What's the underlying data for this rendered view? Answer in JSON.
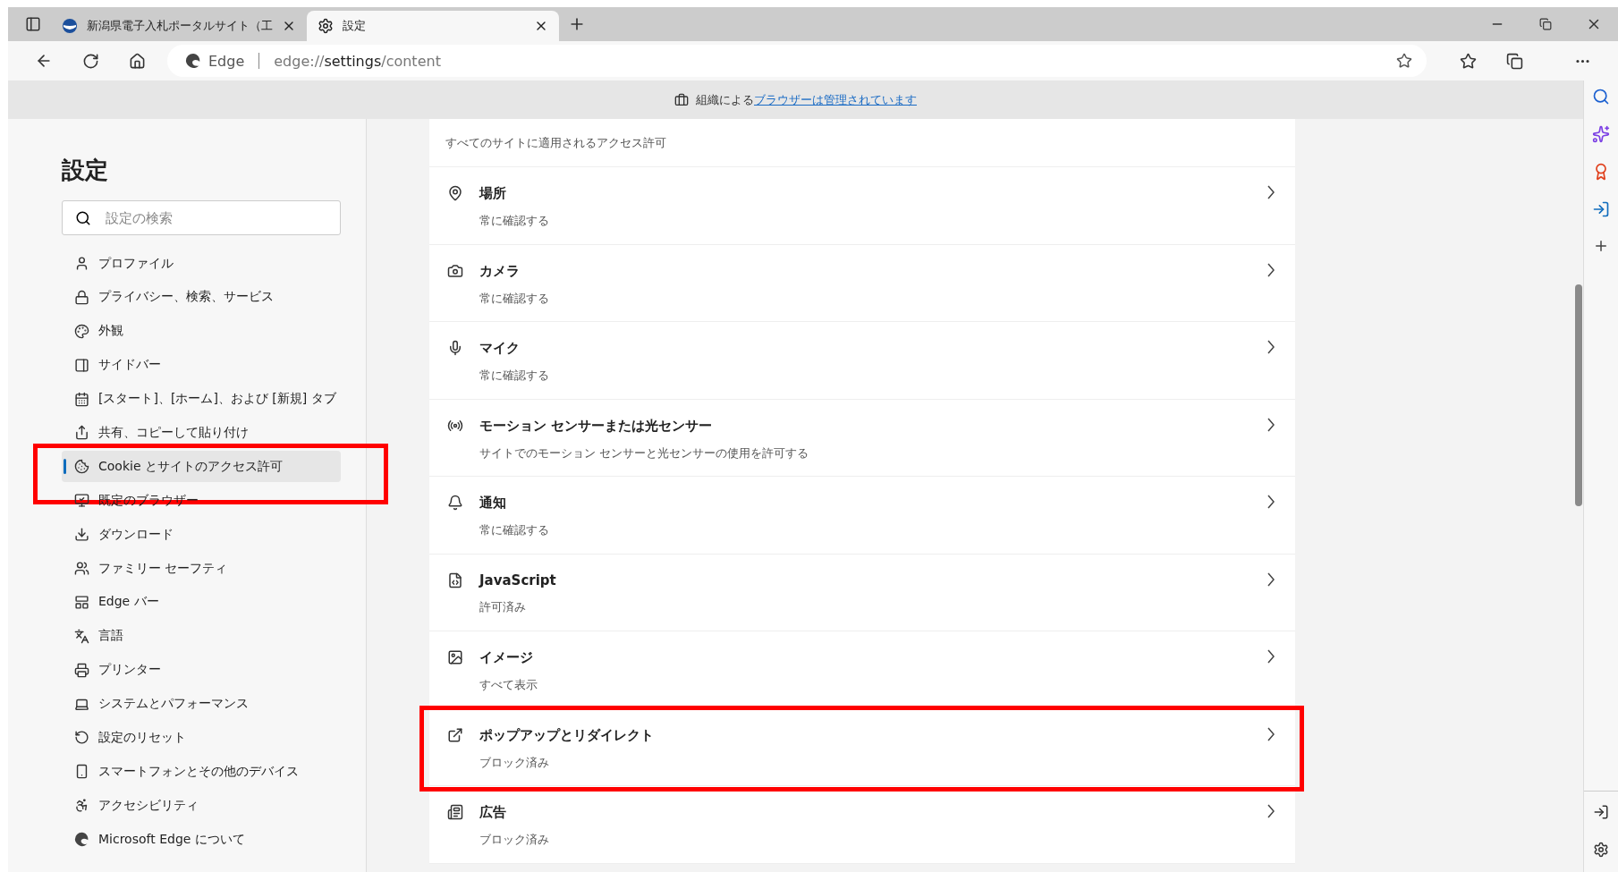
{
  "tabs": [
    {
      "title": "新潟県電子入札ポータルサイト（工",
      "selected": false,
      "kind": "site"
    },
    {
      "title": "設定",
      "selected": true,
      "kind": "settings"
    }
  ],
  "address": {
    "brand": "Edge",
    "url_scheme": "edge://",
    "url_host": "settings",
    "url_path": "/content"
  },
  "info_bar": {
    "text": "組織による",
    "link": "ブラウザーは管理されています"
  },
  "sidebar": {
    "title": "設定",
    "search": {
      "placeholder": "設定の検索"
    },
    "items": [
      {
        "label": "プロファイル",
        "selected": false,
        "highlighted": false
      },
      {
        "label": "プライバシー、検索、サービス",
        "selected": false,
        "highlighted": false
      },
      {
        "label": "外観",
        "selected": false,
        "highlighted": false
      },
      {
        "label": "サイドバー",
        "selected": false,
        "highlighted": false
      },
      {
        "label": "[スタート]、[ホーム]、および [新規] タブ",
        "selected": false,
        "highlighted": false
      },
      {
        "label": "共有、コピーして貼り付け",
        "selected": false,
        "highlighted": false
      },
      {
        "label": "Cookie とサイトのアクセス許可",
        "selected": true,
        "highlighted": true
      },
      {
        "label": "既定のブラウザー",
        "selected": false,
        "highlighted": false
      },
      {
        "label": "ダウンロード",
        "selected": false,
        "highlighted": false
      },
      {
        "label": "ファミリー セーフティ",
        "selected": false,
        "highlighted": false
      },
      {
        "label": "Edge バー",
        "selected": false,
        "highlighted": false
      },
      {
        "label": "言語",
        "selected": false,
        "highlighted": false
      },
      {
        "label": "プリンター",
        "selected": false,
        "highlighted": false
      },
      {
        "label": "システムとパフォーマンス",
        "selected": false,
        "highlighted": false
      },
      {
        "label": "設定のリセット",
        "selected": false,
        "highlighted": false
      },
      {
        "label": "スマートフォンとその他のデバイス",
        "selected": false,
        "highlighted": false
      },
      {
        "label": "アクセシビリティ",
        "selected": false,
        "highlighted": false
      },
      {
        "label": "Microsoft Edge について",
        "selected": false,
        "highlighted": false
      }
    ]
  },
  "content": {
    "section_description": "すべてのサイトに適用されるアクセス許可",
    "rows": [
      {
        "title": "場所",
        "subtitle": "常に確認する",
        "highlighted": false
      },
      {
        "title": "カメラ",
        "subtitle": "常に確認する",
        "highlighted": false
      },
      {
        "title": "マイク",
        "subtitle": "常に確認する",
        "highlighted": false
      },
      {
        "title": "モーション センサーまたは光センサー",
        "subtitle": "サイトでのモーション センサーと光センサーの使用を許可する",
        "highlighted": false
      },
      {
        "title": "通知",
        "subtitle": "常に確認する",
        "highlighted": false
      },
      {
        "title": "JavaScript",
        "subtitle": "許可済み",
        "highlighted": false
      },
      {
        "title": "イメージ",
        "subtitle": "すべて表示",
        "highlighted": false
      },
      {
        "title": "ポップアップとリダイレクト",
        "subtitle": "ブロック済み",
        "highlighted": true
      },
      {
        "title": "広告",
        "subtitle": "ブロック済み",
        "highlighted": false
      }
    ]
  }
}
